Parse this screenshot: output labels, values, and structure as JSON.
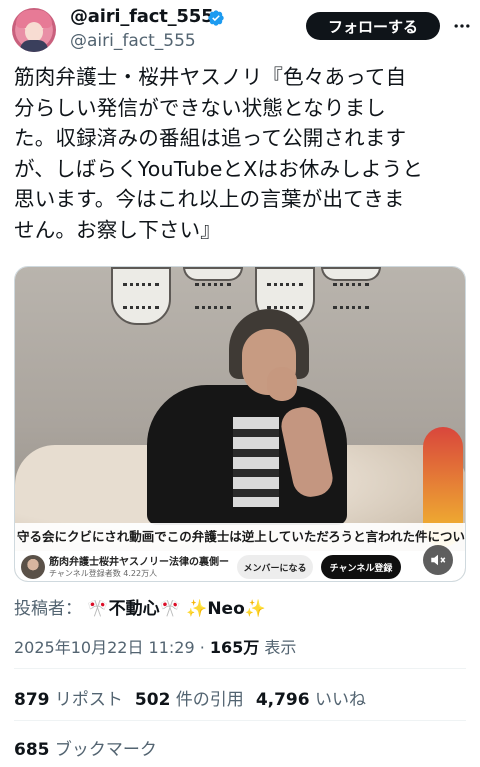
{
  "author": {
    "display_name": "@airi_fact_555",
    "handle": "@airi_fact_555",
    "verified": true
  },
  "follow_button": "フォローする",
  "tweet": {
    "lines": [
      "筋肉弁護士・桜井ヤスノリ『色々あって自",
      "分らしい発信ができない状態となりまし",
      "た。収録済みの番組は追って公開されます",
      "が、しばらくYouTubeとXはお休みしようと",
      "思います。今はこれ以上の言葉が出てきま",
      "せん。お察し下さい』"
    ]
  },
  "media": {
    "caption": "守る会にクビにされ動画でこの弁護士は逆上していただろうと言われた件について",
    "channel_name": "筋肉弁護士桜井ヤスノリー法律の裏側ー",
    "channel_subs": "チャンネル登録者数 4.22万人",
    "member_button": "メンバーになる",
    "subscribe_button": "チャンネル登録"
  },
  "poster": {
    "label": "投稿者：",
    "name1": "🎌不動心🎌",
    "name2": "✨Neo✨"
  },
  "meta": {
    "timestamp": "2025年10月22日 11:29",
    "separator": " · ",
    "views_count": "165万",
    "views_label": " 表示"
  },
  "stats": {
    "reposts_count": "879",
    "reposts_label": " リポスト",
    "quotes_count": "502",
    "quotes_label": " 件の引用",
    "likes_count": "4,796",
    "likes_label": " いいね"
  },
  "bookmarks": {
    "count": "685",
    "label": " ブックマーク"
  },
  "colors": {
    "text_primary": "#0f1419",
    "text_secondary": "#536471",
    "verified_blue": "#1d9bf0",
    "follow_bg": "#0f1419"
  }
}
